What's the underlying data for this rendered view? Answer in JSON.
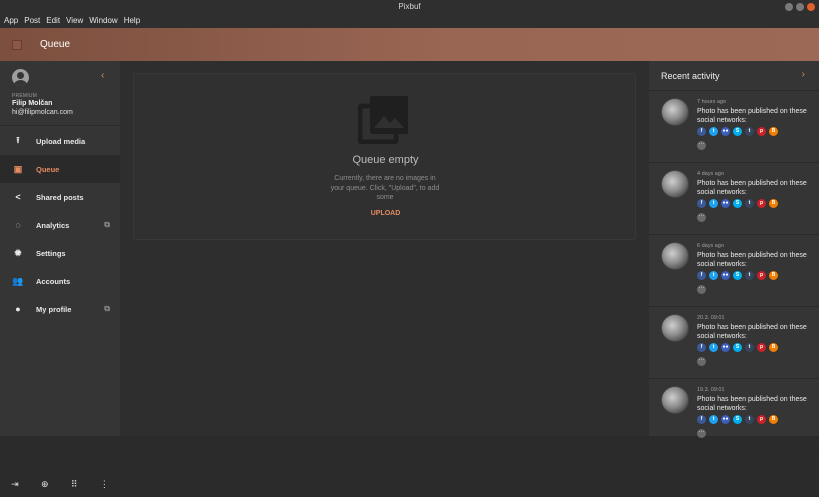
{
  "window": {
    "title": "Pixbuf"
  },
  "menu": [
    "App",
    "Post",
    "Edit",
    "View",
    "Window",
    "Help"
  ],
  "header": {
    "title": "Queue"
  },
  "profile": {
    "plan": "PREMIUM",
    "name": "Filip Molčan",
    "email": "hi@filipmolcan.com"
  },
  "nav": [
    {
      "label": "Upload media",
      "icon": "upload-icon",
      "glyph": "⭱"
    },
    {
      "label": "Queue",
      "icon": "queue-icon",
      "glyph": "▣"
    },
    {
      "label": "Shared posts",
      "icon": "share-icon",
      "glyph": "<"
    },
    {
      "label": "Analytics",
      "icon": "analytics-icon",
      "glyph": "◌"
    },
    {
      "label": "Settings",
      "icon": "gear-icon",
      "glyph": "✹"
    },
    {
      "label": "Accounts",
      "icon": "people-icon",
      "glyph": "👥"
    },
    {
      "label": "My profile",
      "icon": "person-icon",
      "glyph": "●"
    }
  ],
  "bottom_bar": [
    "exit-icon",
    "globe-icon",
    "apps-grid-icon",
    "more-vert-icon"
  ],
  "queue": {
    "empty_title": "Queue empty",
    "empty_desc": "Currently, there are no images in your queue. Click, \"Upload\", to add some",
    "upload_label": "UPLOAD"
  },
  "recent": {
    "title": "Recent activity",
    "message": "Photo has been published on these social networks:",
    "items": [
      {
        "time": "7 hours ago"
      },
      {
        "time": "4 days ago"
      },
      {
        "time": "6 days ago"
      },
      {
        "time": "20.3. 09:01"
      },
      {
        "time": "19.3. 09:01"
      }
    ],
    "networks": [
      {
        "name": "facebook",
        "letter": "f",
        "color": "#3b5998"
      },
      {
        "name": "twitter",
        "letter": "t",
        "color": "#1da1f2"
      },
      {
        "name": "flickr",
        "letter": "●●",
        "color": "#3a5ebd"
      },
      {
        "name": "skype",
        "letter": "S",
        "color": "#00aff0"
      },
      {
        "name": "tumblr",
        "letter": "t",
        "color": "#35465c"
      },
      {
        "name": "pinterest",
        "letter": "p",
        "color": "#cb2027"
      },
      {
        "name": "blogger",
        "letter": "B",
        "color": "#f57d00"
      }
    ]
  },
  "accent_color": "#e58a63"
}
